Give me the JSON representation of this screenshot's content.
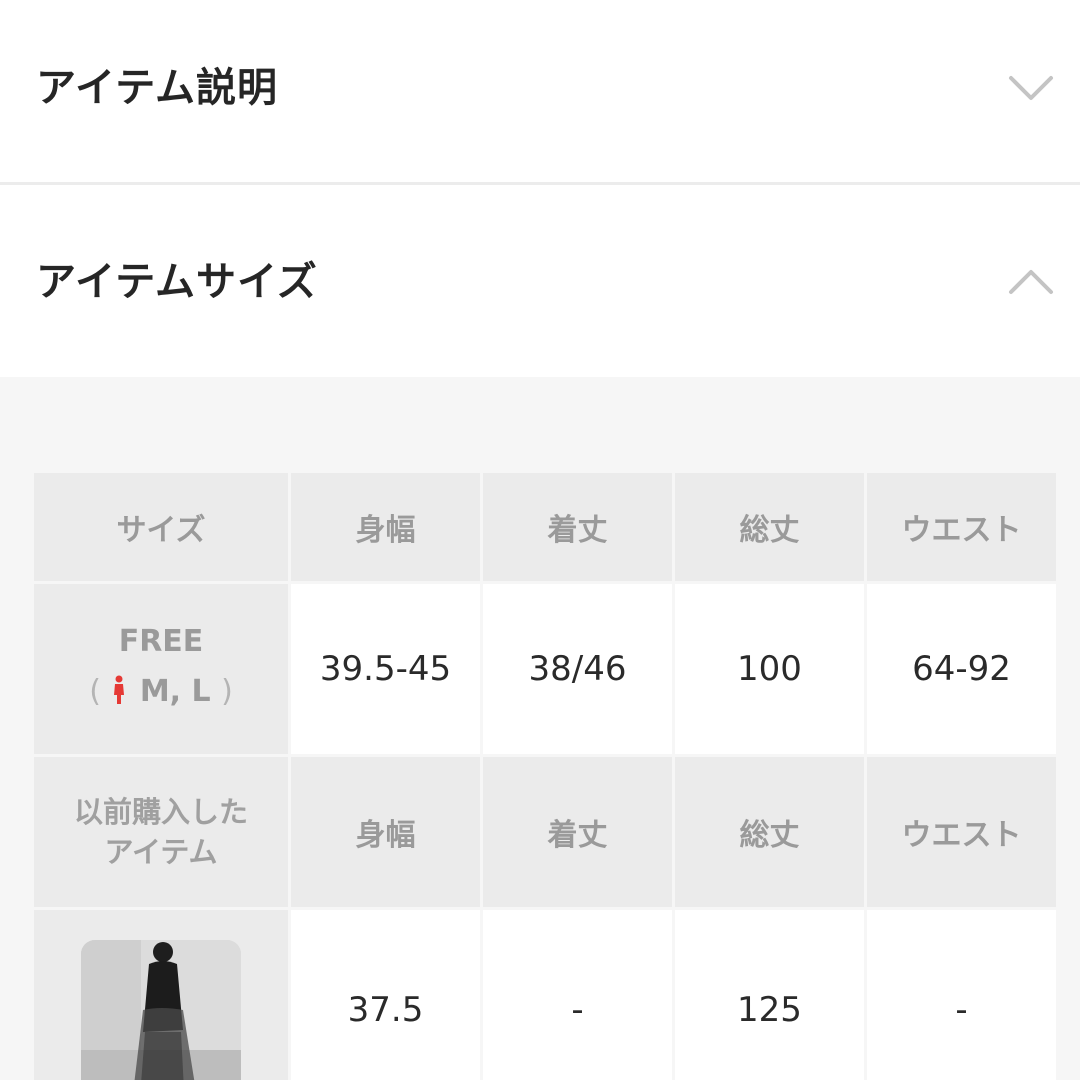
{
  "sections": {
    "description": {
      "title": "アイテム説明",
      "expanded": false
    },
    "size": {
      "title": "アイテムサイズ",
      "expanded": true
    }
  },
  "size_table": {
    "columns": [
      "サイズ",
      "身幅",
      "着丈",
      "総丈",
      "ウエスト"
    ],
    "free_row": {
      "size_label": "FREE",
      "open_paren": "(",
      "fit": "M, L",
      "close_paren": ")",
      "values": [
        "39.5-45",
        "38/46",
        "100",
        "64-92"
      ]
    },
    "previous_header": {
      "label_line1": "以前購入した",
      "label_line2": "アイテム",
      "columns": [
        "身幅",
        "着丈",
        "総丈",
        "ウエスト"
      ]
    },
    "previous_row": {
      "values": [
        "37.5",
        "-",
        "125",
        "-"
      ]
    }
  },
  "colors": {
    "accent_red": "#e53935",
    "header_cell_bg": "#ebebeb",
    "table_area_bg": "#f6f6f6"
  },
  "icons": [
    "chevron-down-icon",
    "chevron-up-icon",
    "person-icon"
  ]
}
